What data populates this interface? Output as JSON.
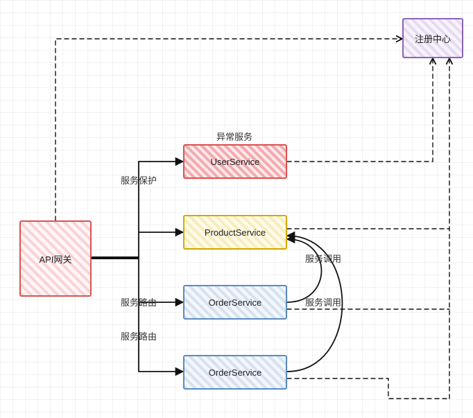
{
  "nodes": {
    "gateway": {
      "label": "API网关"
    },
    "registry": {
      "label": "注册中心"
    },
    "user": {
      "label": "UserService"
    },
    "product": {
      "label": "ProductService"
    },
    "order1": {
      "label": "OrderService"
    },
    "order2": {
      "label": "OrderService"
    }
  },
  "labels": {
    "abnormal": "异常服务",
    "protect": "服务保护",
    "route1": "服务路由",
    "route2": "服务路由",
    "invoke1": "服务调用",
    "invoke2": "服务调用"
  }
}
